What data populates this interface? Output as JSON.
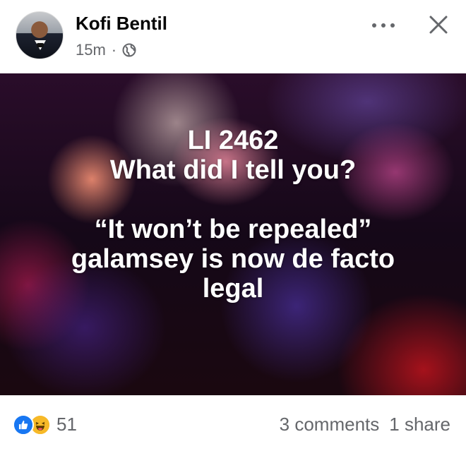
{
  "post": {
    "author_name": "Kofi Bentil",
    "time": "15m",
    "separator": "·",
    "audience_icon": "globe-icon",
    "text_lines": [
      "LI 2462",
      "What did I tell you?",
      "",
      "“It won’t be repealed”",
      "galamsey is now de facto",
      "legal"
    ]
  },
  "header_actions": {
    "more_icon": "more-icon",
    "close_icon": "close-icon"
  },
  "stats": {
    "reaction_icons": [
      "like-icon",
      "haha-icon"
    ],
    "reaction_count": "51",
    "comments": "3 comments",
    "shares": "1 share"
  },
  "colors": {
    "text_primary": "#050505",
    "text_secondary": "#65676b",
    "like_blue": "#1877f2",
    "haha_yellow": "#f7b928"
  }
}
